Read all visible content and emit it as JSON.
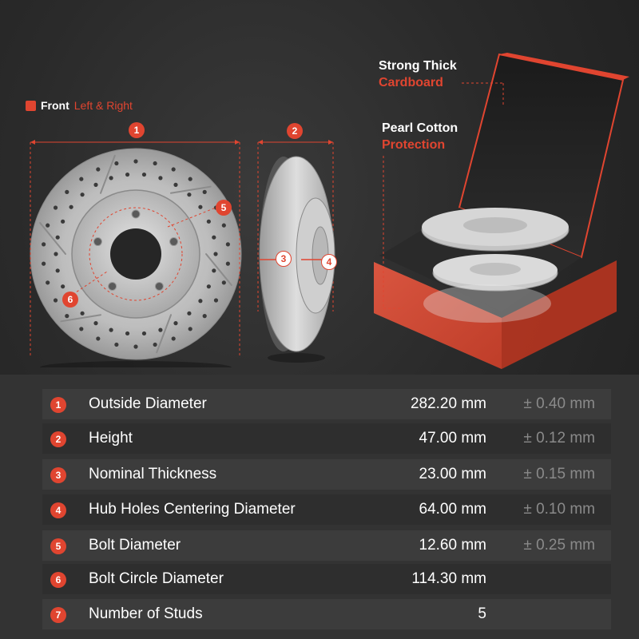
{
  "front": {
    "label": "Front",
    "sub": "Left & Right"
  },
  "callouts": {
    "box_line1": "Strong Thick",
    "box_line2": "Cardboard",
    "foam_line1": "Pearl Cotton",
    "foam_line2": "Protection"
  },
  "diagram_numbers": {
    "n1": "1",
    "n2": "2",
    "n3": "3",
    "n4": "4",
    "n5": "5",
    "n6": "6"
  },
  "specs": [
    {
      "num": "1",
      "label": "Outside Diameter",
      "value": "282.20 mm",
      "tolerance": "± 0.40 mm"
    },
    {
      "num": "2",
      "label": "Height",
      "value": "47.00 mm",
      "tolerance": "± 0.12 mm"
    },
    {
      "num": "3",
      "label": "Nominal Thickness",
      "value": "23.00 mm",
      "tolerance": "± 0.15 mm"
    },
    {
      "num": "4",
      "label": "Hub Holes Centering Diameter",
      "value": "64.00 mm",
      "tolerance": "± 0.10 mm"
    },
    {
      "num": "5",
      "label": "Bolt Diameter",
      "value": "12.60 mm",
      "tolerance": "± 0.25 mm"
    },
    {
      "num": "6",
      "label": "Bolt Circle Diameter",
      "value": "114.30 mm",
      "tolerance": ""
    },
    {
      "num": "7",
      "label": "Number of Studs",
      "value": "5",
      "tolerance": ""
    }
  ],
  "colors": {
    "accent": "#e04530",
    "background": "#2a2a2a"
  }
}
